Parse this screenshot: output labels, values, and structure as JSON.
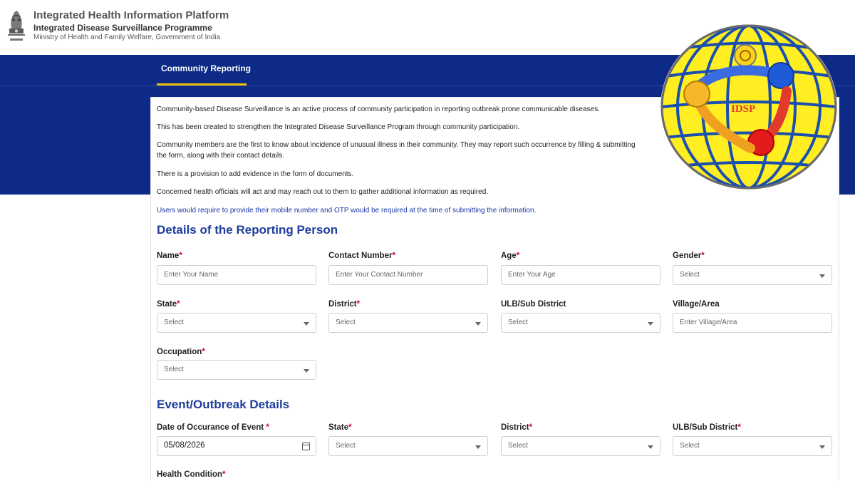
{
  "header": {
    "title": "Integrated Health Information Platform",
    "subtitle": "Integrated Disease Surveillance Programme",
    "ministry": "Ministry of Health and Family Welfare, Government of India"
  },
  "nav": {
    "tab_label": "Community Reporting"
  },
  "info": {
    "p1": "Community-based Disease Surveillance is an active process of community participation in reporting outbreak prone communicable diseases.",
    "p2": "This has been created to strengthen the Integrated Disease Surveillance Program through community participation.",
    "p3a": "Community members are the first to know about incidence of unusual illness in their community. They may report such occurrence by filling & submitting",
    "p3b": "the form, along with their contact details.",
    "p4": "There is a provision to add evidence in the form of documents.",
    "p5": "Concerned health officials will act and may reach out to them to gather additional information as required.",
    "p6": "Users would require to provide their mobile number and OTP would be required at the time of submitting the information."
  },
  "reporting": {
    "title": "Details of the Reporting Person",
    "name": {
      "label": "Name",
      "placeholder": "Enter Your Name"
    },
    "contact": {
      "label": "Contact Number",
      "placeholder": "Enter Your Contact Number"
    },
    "age": {
      "label": "Age",
      "placeholder": "Enter Your Age"
    },
    "gender": {
      "label": "Gender",
      "value": "Select"
    },
    "state": {
      "label": "State",
      "value": "Select"
    },
    "district": {
      "label": "District",
      "value": "Select"
    },
    "ulb": {
      "label": "ULB/Sub District",
      "value": "Select"
    },
    "village": {
      "label": "Village/Area",
      "placeholder": "Enter Village/Area"
    },
    "occupation": {
      "label": "Occupation",
      "value": "Select"
    }
  },
  "event": {
    "title": "Event/Outbreak Details",
    "date": {
      "label": "Date of Occurance of Event",
      "value": "05/08/2026"
    },
    "state": {
      "label": "State",
      "value": "Select"
    },
    "district": {
      "label": "District",
      "value": "Select"
    },
    "ulb": {
      "label": "ULB/Sub District",
      "value": "Select"
    },
    "health_condition": {
      "label": "Health Condition"
    }
  },
  "required_marker": "*",
  "logo": {
    "text": "IDSP"
  },
  "colors": {
    "band": "#0d2b86",
    "accent": "#f2c200",
    "heading": "#1f3d9a",
    "required": "#d0021b"
  }
}
